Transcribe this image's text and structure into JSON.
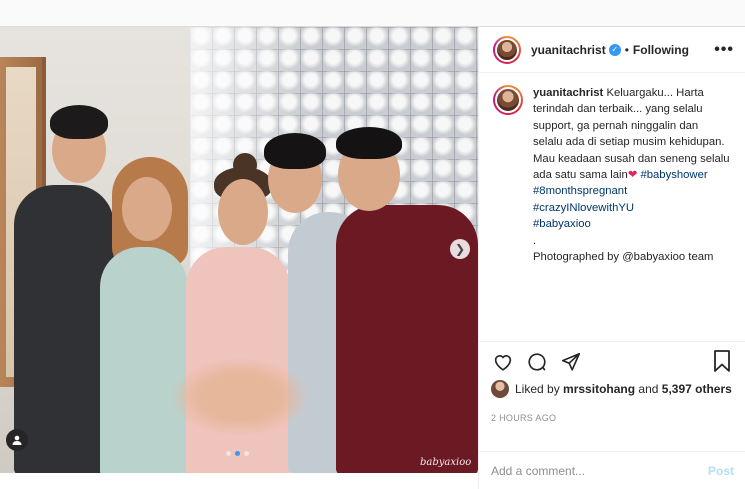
{
  "post": {
    "author": "yuanitachrist",
    "follow_state": "Following",
    "watermark": "babyaxioo"
  },
  "caption": {
    "user": "yuanitachrist",
    "lines": [
      "Keluargaku... Harta",
      "terindah dan terbaik... yang selalu",
      "support, ga pernah ninggalin dan",
      "selalu ada di setiap musim kehidupan.",
      "Mau keadaan susah dan seneng selalu",
      "ada satu sama lain"
    ],
    "hashtags": [
      "#babyshower",
      "#8monthspregnant",
      "#crazyINlovewithYU",
      "#babyaxioo"
    ],
    "separator": ".",
    "credit": "Photographed by @babyaxioo team"
  },
  "likes": {
    "prefix": "Liked by",
    "user": "mrssitohang",
    "conjunction": "and",
    "count": "5,397 others"
  },
  "timestamp": "2 HOURS AGO",
  "comment": {
    "placeholder": "Add a comment...",
    "post_label": "Post"
  },
  "icons": {
    "verified": "verified-badge-icon",
    "more": "more-options-icon",
    "like": "heart-icon",
    "comment": "comment-icon",
    "share": "share-icon",
    "save": "bookmark-icon",
    "next": "chevron-right-icon",
    "tags": "person-tag-icon"
  },
  "colors": {
    "link": "#00376b",
    "accent": "#3897f0",
    "heart": "#e0245e",
    "post_disabled": "#b2dffc"
  },
  "carousel": {
    "total": 3,
    "active": 1
  }
}
